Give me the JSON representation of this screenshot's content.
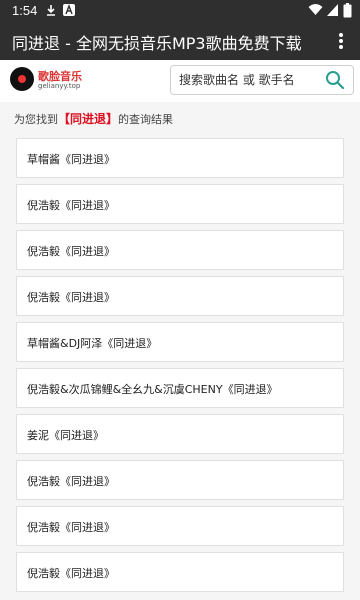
{
  "status_bar": {
    "time": "1:54",
    "icons": [
      "download-icon",
      "a-box-icon",
      "wifi-icon",
      "signal-icon",
      "battery-icon"
    ]
  },
  "app_bar": {
    "title": "同进退 - 全网无损音乐MP3歌曲免费下载",
    "menu_icon": "more-vert-icon"
  },
  "header": {
    "logo_text": "歌脸音乐",
    "logo_sub": "gelianyy.top",
    "search_placeholder": "搜索歌曲名 或 歌手名"
  },
  "results": {
    "prefix": "为您找到",
    "keyword": "【同进退】",
    "suffix": "的查询结果",
    "items": [
      "草帽酱《同进退》",
      "倪浩毅《同进退》",
      "倪浩毅《同进退》",
      "倪浩毅《同进退》",
      "草帽酱&DJ阿泽《同进退》",
      "倪浩毅&次瓜锦鲤&全幺九&沉虞CHENY《同进退》",
      "姜泥《同进退》",
      "倪浩毅《同进退》",
      "倪浩毅《同进退》",
      "倪浩毅《同进退》"
    ]
  },
  "colors": {
    "bar": "#2f2f2f",
    "highlight": "#dd1122",
    "search_icon": "#2a9d8f",
    "list_bg": "#f5f5f5"
  }
}
